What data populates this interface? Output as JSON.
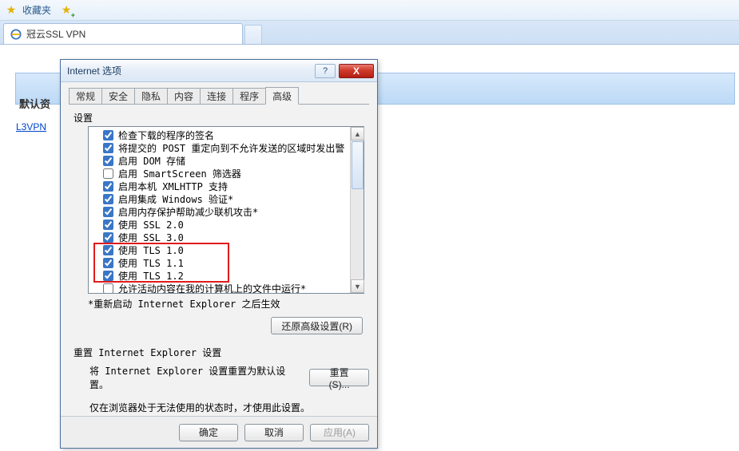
{
  "favorites": {
    "label": "收藏夹"
  },
  "browser_tab": {
    "title": "冠云SSL VPN"
  },
  "page": {
    "default_resources": "默认资",
    "link": "L3VPN"
  },
  "dialog": {
    "title": "Internet 选项",
    "help_icon": "?",
    "close_icon": "X",
    "tabs": [
      "常规",
      "安全",
      "隐私",
      "内容",
      "连接",
      "程序",
      "高级"
    ],
    "active_tab_index": 6,
    "settings_label": "设置",
    "items": [
      {
        "label": "检查下载的程序的签名",
        "checked": true
      },
      {
        "label": "将提交的 POST 重定向到不允许发送的区域时发出警",
        "checked": true
      },
      {
        "label": "启用 DOM 存储",
        "checked": true
      },
      {
        "label": "启用 SmartScreen 筛选器",
        "checked": false
      },
      {
        "label": "启用本机 XMLHTTP 支持",
        "checked": true
      },
      {
        "label": "启用集成 Windows 验证*",
        "checked": true
      },
      {
        "label": "启用内存保护帮助减少联机攻击*",
        "checked": true
      },
      {
        "label": "使用 SSL 2.0",
        "checked": true
      },
      {
        "label": "使用 SSL 3.0",
        "checked": true
      },
      {
        "label": "使用 TLS 1.0",
        "checked": true
      },
      {
        "label": "使用 TLS 1.1",
        "checked": true
      },
      {
        "label": "使用 TLS 1.2",
        "checked": true
      },
      {
        "label": "允许活动内容在我的计算机上的文件中运行*",
        "checked": false
      }
    ],
    "restart_note": "*重新启动 Internet Explorer 之后生效",
    "restore_btn": "还原高级设置(R)",
    "reset_header": "重置 Internet Explorer 设置",
    "reset_desc": "将 Internet Explorer 设置重置为默认设置。",
    "reset_btn": "重置(S)...",
    "reset_note": "仅在浏览器处于无法使用的状态时，才使用此设置。",
    "footer": {
      "ok": "确定",
      "cancel": "取消",
      "apply": "应用(A)"
    }
  }
}
